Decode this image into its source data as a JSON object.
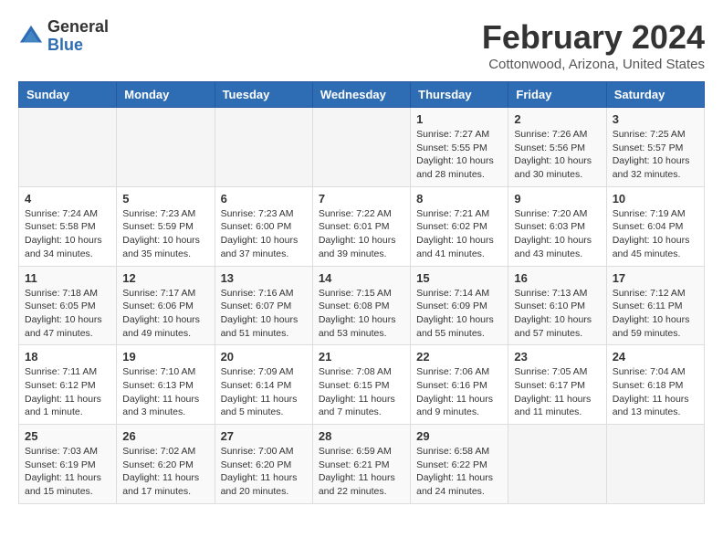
{
  "logo": {
    "general": "General",
    "blue": "Blue"
  },
  "header": {
    "month": "February 2024",
    "location": "Cottonwood, Arizona, United States"
  },
  "weekdays": [
    "Sunday",
    "Monday",
    "Tuesday",
    "Wednesday",
    "Thursday",
    "Friday",
    "Saturday"
  ],
  "weeks": [
    [
      {
        "day": "",
        "info": ""
      },
      {
        "day": "",
        "info": ""
      },
      {
        "day": "",
        "info": ""
      },
      {
        "day": "",
        "info": ""
      },
      {
        "day": "1",
        "info": "Sunrise: 7:27 AM\nSunset: 5:55 PM\nDaylight: 10 hours\nand 28 minutes."
      },
      {
        "day": "2",
        "info": "Sunrise: 7:26 AM\nSunset: 5:56 PM\nDaylight: 10 hours\nand 30 minutes."
      },
      {
        "day": "3",
        "info": "Sunrise: 7:25 AM\nSunset: 5:57 PM\nDaylight: 10 hours\nand 32 minutes."
      }
    ],
    [
      {
        "day": "4",
        "info": "Sunrise: 7:24 AM\nSunset: 5:58 PM\nDaylight: 10 hours\nand 34 minutes."
      },
      {
        "day": "5",
        "info": "Sunrise: 7:23 AM\nSunset: 5:59 PM\nDaylight: 10 hours\nand 35 minutes."
      },
      {
        "day": "6",
        "info": "Sunrise: 7:23 AM\nSunset: 6:00 PM\nDaylight: 10 hours\nand 37 minutes."
      },
      {
        "day": "7",
        "info": "Sunrise: 7:22 AM\nSunset: 6:01 PM\nDaylight: 10 hours\nand 39 minutes."
      },
      {
        "day": "8",
        "info": "Sunrise: 7:21 AM\nSunset: 6:02 PM\nDaylight: 10 hours\nand 41 minutes."
      },
      {
        "day": "9",
        "info": "Sunrise: 7:20 AM\nSunset: 6:03 PM\nDaylight: 10 hours\nand 43 minutes."
      },
      {
        "day": "10",
        "info": "Sunrise: 7:19 AM\nSunset: 6:04 PM\nDaylight: 10 hours\nand 45 minutes."
      }
    ],
    [
      {
        "day": "11",
        "info": "Sunrise: 7:18 AM\nSunset: 6:05 PM\nDaylight: 10 hours\nand 47 minutes."
      },
      {
        "day": "12",
        "info": "Sunrise: 7:17 AM\nSunset: 6:06 PM\nDaylight: 10 hours\nand 49 minutes."
      },
      {
        "day": "13",
        "info": "Sunrise: 7:16 AM\nSunset: 6:07 PM\nDaylight: 10 hours\nand 51 minutes."
      },
      {
        "day": "14",
        "info": "Sunrise: 7:15 AM\nSunset: 6:08 PM\nDaylight: 10 hours\nand 53 minutes."
      },
      {
        "day": "15",
        "info": "Sunrise: 7:14 AM\nSunset: 6:09 PM\nDaylight: 10 hours\nand 55 minutes."
      },
      {
        "day": "16",
        "info": "Sunrise: 7:13 AM\nSunset: 6:10 PM\nDaylight: 10 hours\nand 57 minutes."
      },
      {
        "day": "17",
        "info": "Sunrise: 7:12 AM\nSunset: 6:11 PM\nDaylight: 10 hours\nand 59 minutes."
      }
    ],
    [
      {
        "day": "18",
        "info": "Sunrise: 7:11 AM\nSunset: 6:12 PM\nDaylight: 11 hours\nand 1 minute."
      },
      {
        "day": "19",
        "info": "Sunrise: 7:10 AM\nSunset: 6:13 PM\nDaylight: 11 hours\nand 3 minutes."
      },
      {
        "day": "20",
        "info": "Sunrise: 7:09 AM\nSunset: 6:14 PM\nDaylight: 11 hours\nand 5 minutes."
      },
      {
        "day": "21",
        "info": "Sunrise: 7:08 AM\nSunset: 6:15 PM\nDaylight: 11 hours\nand 7 minutes."
      },
      {
        "day": "22",
        "info": "Sunrise: 7:06 AM\nSunset: 6:16 PM\nDaylight: 11 hours\nand 9 minutes."
      },
      {
        "day": "23",
        "info": "Sunrise: 7:05 AM\nSunset: 6:17 PM\nDaylight: 11 hours\nand 11 minutes."
      },
      {
        "day": "24",
        "info": "Sunrise: 7:04 AM\nSunset: 6:18 PM\nDaylight: 11 hours\nand 13 minutes."
      }
    ],
    [
      {
        "day": "25",
        "info": "Sunrise: 7:03 AM\nSunset: 6:19 PM\nDaylight: 11 hours\nand 15 minutes."
      },
      {
        "day": "26",
        "info": "Sunrise: 7:02 AM\nSunset: 6:20 PM\nDaylight: 11 hours\nand 17 minutes."
      },
      {
        "day": "27",
        "info": "Sunrise: 7:00 AM\nSunset: 6:20 PM\nDaylight: 11 hours\nand 20 minutes."
      },
      {
        "day": "28",
        "info": "Sunrise: 6:59 AM\nSunset: 6:21 PM\nDaylight: 11 hours\nand 22 minutes."
      },
      {
        "day": "29",
        "info": "Sunrise: 6:58 AM\nSunset: 6:22 PM\nDaylight: 11 hours\nand 24 minutes."
      },
      {
        "day": "",
        "info": ""
      },
      {
        "day": "",
        "info": ""
      }
    ]
  ]
}
